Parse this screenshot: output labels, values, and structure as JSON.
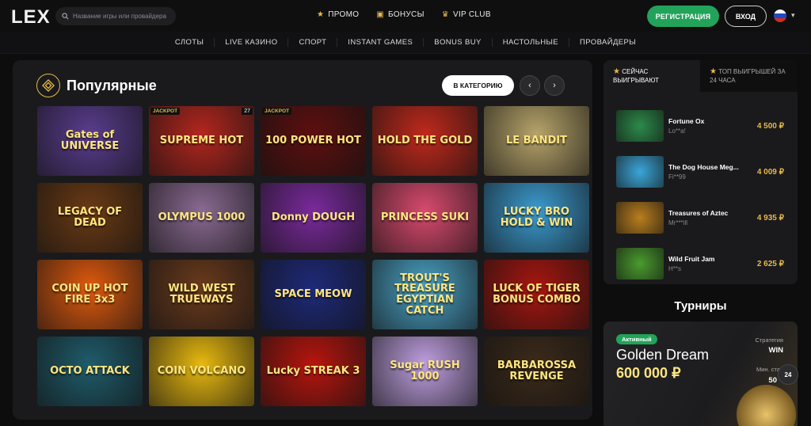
{
  "header": {
    "logo": "LEX",
    "search_placeholder": "Название игры или провайдера",
    "nav": [
      {
        "label": "ПРОМО"
      },
      {
        "label": "БОНУСЫ"
      },
      {
        "label": "VIP CLUB"
      }
    ],
    "register_label": "РЕГИСТРАЦИЯ",
    "login_label": "ВХОД"
  },
  "categories": [
    "СЛОТЫ",
    "LIVE КАЗИНО",
    "СПОРТ",
    "INSTANT GAMES",
    "BONUS BUY",
    "НАСТОЛЬНЫЕ",
    "ПРОВАЙДЕРЫ"
  ],
  "popular": {
    "title": "Популярные",
    "to_category_label": "В КАТЕГОРИЮ",
    "games": [
      {
        "name": "Gates of UNIVERSE",
        "bg": "#5a3d8f"
      },
      {
        "name": "SUPREME HOT",
        "bg": "#b3261e",
        "badge": "JACKPOT",
        "count": "27"
      },
      {
        "name": "100 POWER HOT",
        "bg": "#5e0f0f",
        "badge": "JACKPOT"
      },
      {
        "name": "HOLD THE GOLD",
        "bg": "#c0291c"
      },
      {
        "name": "LE BANDIT",
        "bg": "#b7a46a"
      },
      {
        "name": "LEGACY OF DEAD",
        "bg": "#6b3a14"
      },
      {
        "name": "OLYMPUS 1000",
        "bg": "#8a6a92"
      },
      {
        "name": "Donny DOUGH",
        "bg": "#7a2a9c"
      },
      {
        "name": "PRINCESS SUKI",
        "bg": "#d94a6e"
      },
      {
        "name": "LUCKY BRO HOLD & WIN",
        "bg": "#3b9bd0"
      },
      {
        "name": "COIN UP HOT FIRE 3x3",
        "bg": "#e05a0e"
      },
      {
        "name": "WILD WEST TRUEWAYS",
        "bg": "#6a3a1c"
      },
      {
        "name": "SPACE MEOW",
        "bg": "#1e2a7a"
      },
      {
        "name": "TROUT'S TREASURE EGYPTIAN CATCH",
        "bg": "#4aa3c7"
      },
      {
        "name": "LUCK OF TIGER BONUS COMBO",
        "bg": "#a8160f"
      },
      {
        "name": "OCTO ATTACK",
        "bg": "#1f5c6b"
      },
      {
        "name": "COIN VOLCANO",
        "bg": "#e8b90f"
      },
      {
        "name": "Lucky STREAK 3",
        "bg": "#b8150e"
      },
      {
        "name": "Sugar RUSH 1000",
        "bg": "#bf9fe0"
      },
      {
        "name": "BARBAROSSA REVENGE",
        "bg": "#3c2a1a"
      }
    ]
  },
  "winners": {
    "tab_now": "СЕЙЧАС ВЫИГРЫВАЮТ",
    "tab_top": "ТОП ВЫИГРЫШЕЙ ЗА 24 ЧАСА",
    "list": [
      {
        "game": "Fortune Ox",
        "user": "Lo**a!",
        "amount": "4 500 ₽",
        "bg": "#2c8a4a"
      },
      {
        "game": "The Dog House Meg...",
        "user": "Fi**99",
        "amount": "4 009 ₽",
        "bg": "#3ba6d8"
      },
      {
        "game": "Treasures of Aztec",
        "user": "Mr***ill",
        "amount": "4 935 ₽",
        "bg": "#b97e1e"
      },
      {
        "game": "Wild Fruit Jam",
        "user": "H**s",
        "amount": "2 625 ₽",
        "bg": "#4a9c2e"
      }
    ]
  },
  "tournaments": {
    "title": "Турниры",
    "status": "Активный",
    "name": "Golden Dream",
    "prize": "600 000 ₽",
    "strategy_label": "Стратегия",
    "strategy_value": "WIN",
    "min_bet_label": "Мин. став",
    "min_bet_value": "50"
  },
  "support_label": "24"
}
